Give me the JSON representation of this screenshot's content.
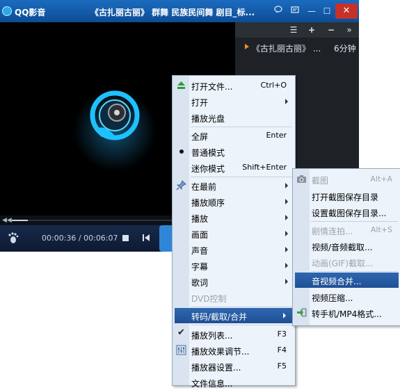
{
  "titlebar": {
    "app_name": "QQ影音",
    "video_title": "《古扎丽古丽》 群舞 民族民间舞 剧目_标...",
    "buttons": {
      "close": "✕",
      "minimize": "—",
      "maximize": "☐"
    }
  },
  "playlist": {
    "items": [
      {
        "title": "《古扎丽古丽》 ...",
        "duration": "6分钟"
      }
    ]
  },
  "controls": {
    "time_current": "00:00:36",
    "time_total": "00:06:07",
    "time_separator": " / ",
    "progress_fraction": 0.098
  },
  "main_menu": {
    "items": [
      {
        "label": "打开文件...",
        "shortcut": "Ctrl+O"
      },
      {
        "label": "打开"
      },
      {
        "label": "播放光盘"
      },
      {
        "label": "全屏",
        "shortcut": "Enter"
      },
      {
        "label": "普通模式"
      },
      {
        "label": "迷你模式",
        "shortcut": "Shift+Enter"
      },
      {
        "label": "在最前"
      },
      {
        "label": "播放顺序"
      },
      {
        "label": "播放"
      },
      {
        "label": "画面"
      },
      {
        "label": "声音"
      },
      {
        "label": "字幕"
      },
      {
        "label": "歌词"
      },
      {
        "label": "DVD控制"
      },
      {
        "label": "转码/截取/合并"
      },
      {
        "label": "播放列表...",
        "shortcut": "F3"
      },
      {
        "label": "播放效果调节...",
        "shortcut": "F4"
      },
      {
        "label": "播放器设置...",
        "shortcut": "F5"
      },
      {
        "label": "文件信息..."
      }
    ]
  },
  "sub_menu": {
    "items": [
      {
        "label": "截图",
        "shortcut": "Alt+A"
      },
      {
        "label": "打开截图保存目录"
      },
      {
        "label": "设置截图保存目录..."
      },
      {
        "label": "剧情连拍...",
        "shortcut": "Alt+S"
      },
      {
        "label": "视频/音频截取..."
      },
      {
        "label": "动画(GIF)截取..."
      },
      {
        "label": "音视频合并..."
      },
      {
        "label": "视频压缩..."
      },
      {
        "label": "转手机/MP4格式..."
      }
    ]
  },
  "colors": {
    "title_bar": "#1b6bbf",
    "menu_highlight": "#1f4f94",
    "close_button": "#c8302a",
    "playlist_arrow": "#f2911b"
  }
}
